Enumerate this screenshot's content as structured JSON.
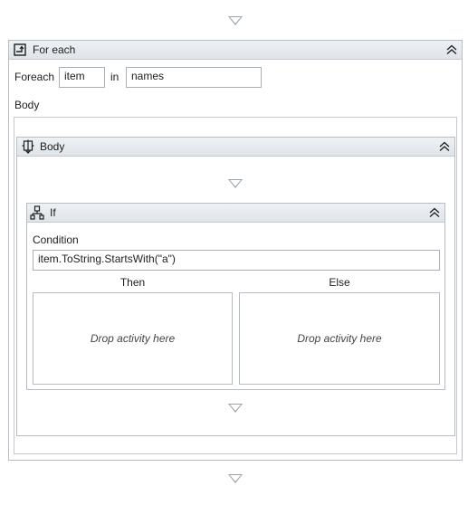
{
  "foreach": {
    "title": "For each",
    "foreach_label": "Foreach",
    "item_value": "item",
    "in_label": "in",
    "collection_value": "names",
    "body_label": "Body"
  },
  "body": {
    "title": "Body"
  },
  "if_activity": {
    "title": "If",
    "condition_label": "Condition",
    "condition_value": "item.ToString.StartsWith(\"a\")",
    "then_label": "Then",
    "else_label": "Else",
    "then_drop": "Drop activity here",
    "else_drop": "Drop activity here"
  },
  "icons": {
    "drop_target": "drop-arrow-icon",
    "collapse": "collapse-chevrons-icon",
    "foreach": "foreach-icon",
    "sequence": "sequence-icon",
    "if": "if-icon"
  },
  "colors": {
    "header_bg": "#e6eaee",
    "border": "#b7bdc3",
    "arrow": "#9aa4ae"
  }
}
